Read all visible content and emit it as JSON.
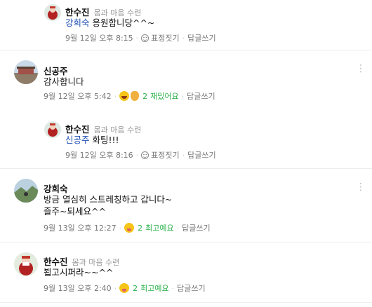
{
  "comments": [
    {
      "author": "한수진",
      "tag": "몸과 마음 수련",
      "mention": "강희숙",
      "text": " 응원합니당^^~",
      "time": "9월 12일 오후 8:15",
      "react": "표정짓기",
      "reply": "답글쓰기"
    },
    {
      "author": "신공주",
      "text": "감사합니다",
      "time": "9월 12일 오후 5:42",
      "count": "2",
      "react": "재밌어요",
      "reply": "답글쓰기"
    },
    {
      "author": "한수진",
      "tag": "몸과 마음 수련",
      "mention": "신공주",
      "text": " 화팅!!!",
      "time": "9월 12일 오후 8:16",
      "react": "표정짓기",
      "reply": "답글쓰기"
    },
    {
      "author": "강희숙",
      "text_line1": "방금  열심히 스트레칭하고 갑니다~",
      "text_line2": "즐주~되세요^^",
      "time": "9월 13일 오후 12:27",
      "count": "2",
      "react": "최고예요",
      "reply": "답글쓰기"
    },
    {
      "author": "한수진",
      "tag": "몸과 마음 수련",
      "text": "뵙고시퍼라~~^^",
      "time": "9월 13일 오후 2:40",
      "count": "2",
      "react": "최고예요",
      "reply": "답글쓰기"
    }
  ],
  "icons": {
    "smile": "smile-icon",
    "more": "more-icon"
  }
}
